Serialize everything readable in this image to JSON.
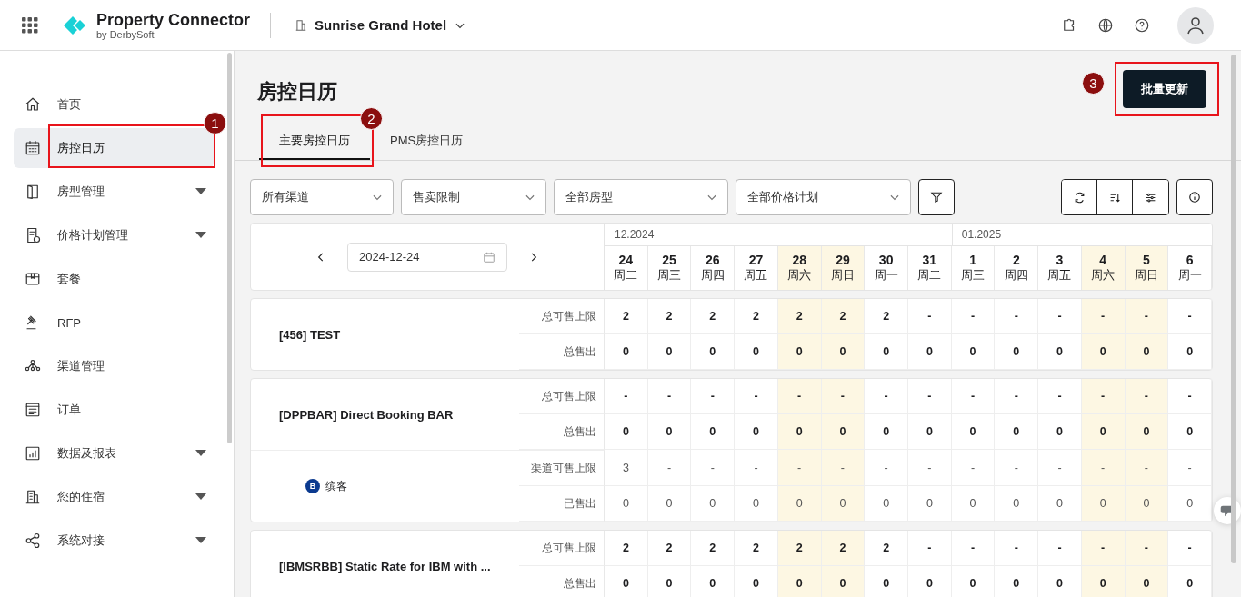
{
  "header": {
    "title": "Property Connector",
    "subtitle": "by DerbySoft",
    "hotel": "Sunrise Grand Hotel"
  },
  "sidebar": {
    "items": [
      {
        "label": "首页",
        "selected": false,
        "has_submenu": false
      },
      {
        "label": "房控日历",
        "selected": true,
        "has_submenu": false,
        "callout": {
          "number": "1"
        }
      },
      {
        "label": "房型管理",
        "selected": false,
        "has_submenu": true
      },
      {
        "label": "价格计划管理",
        "selected": false,
        "has_submenu": true
      },
      {
        "label": "套餐",
        "selected": false,
        "has_submenu": false
      },
      {
        "label": "RFP",
        "selected": false,
        "has_submenu": false
      },
      {
        "label": "渠道管理",
        "selected": false,
        "has_submenu": false
      },
      {
        "label": "订单",
        "selected": false,
        "has_submenu": false
      },
      {
        "label": "数据及报表",
        "selected": false,
        "has_submenu": true
      },
      {
        "label": "您的住宿",
        "selected": false,
        "has_submenu": true
      },
      {
        "label": "系统对接",
        "selected": false,
        "has_submenu": true
      }
    ]
  },
  "page": {
    "title": "房控日历",
    "action": {
      "label": "批量更新",
      "callout": {
        "number": "3"
      }
    }
  },
  "tabs": [
    {
      "label": "主要房控日历",
      "selected": true,
      "callout": {
        "number": "2"
      }
    },
    {
      "label": "PMS房控日历",
      "selected": false
    }
  ],
  "filters": [
    {
      "value": "所有渠道"
    },
    {
      "value": "售卖限制"
    },
    {
      "value": "全部房型"
    },
    {
      "value": "全部价格计划"
    }
  ],
  "date_field": {
    "value": "2024-12-24"
  },
  "months": [
    {
      "label": "12.2024",
      "days": [
        {
          "day": "24",
          "weekday": "周二",
          "weekend": false
        },
        {
          "day": "25",
          "weekday": "周三",
          "weekend": false
        },
        {
          "day": "26",
          "weekday": "周四",
          "weekend": false
        },
        {
          "day": "27",
          "weekday": "周五",
          "weekend": false
        },
        {
          "day": "28",
          "weekday": "周六",
          "weekend": true
        },
        {
          "day": "29",
          "weekday": "周日",
          "weekend": true
        },
        {
          "day": "30",
          "weekday": "周一",
          "weekend": false
        },
        {
          "day": "31",
          "weekday": "周二",
          "weekend": false
        }
      ]
    },
    {
      "label": "01.2025",
      "days": [
        {
          "day": "1",
          "weekday": "周三",
          "weekend": false
        },
        {
          "day": "2",
          "weekday": "周四",
          "weekend": false
        },
        {
          "day": "3",
          "weekday": "周五",
          "weekend": false
        },
        {
          "day": "4",
          "weekday": "周六",
          "weekend": true
        },
        {
          "day": "5",
          "weekday": "周日",
          "weekend": true
        },
        {
          "day": "6",
          "weekday": "周一",
          "weekend": false
        }
      ]
    }
  ],
  "rooms": [
    {
      "name": "[456] TEST",
      "rows": [
        {
          "label": "总可售上限",
          "values": [
            "2",
            "2",
            "2",
            "2",
            "2",
            "2",
            "2",
            "-",
            "-",
            "-",
            "-",
            "-",
            "-",
            "-"
          ]
        },
        {
          "label": "总售出",
          "values": [
            "0",
            "0",
            "0",
            "0",
            "0",
            "0",
            "0",
            "0",
            "0",
            "0",
            "0",
            "0",
            "0",
            "0"
          ]
        }
      ]
    },
    {
      "name": "[DPPBAR] Direct Booking BAR",
      "rows": [
        {
          "label": "总可售上限",
          "values": [
            "-",
            "-",
            "-",
            "-",
            "-",
            "-",
            "-",
            "-",
            "-",
            "-",
            "-",
            "-",
            "-",
            "-"
          ]
        },
        {
          "label": "总售出",
          "values": [
            "0",
            "0",
            "0",
            "0",
            "0",
            "0",
            "0",
            "0",
            "0",
            "0",
            "0",
            "0",
            "0",
            "0"
          ]
        }
      ],
      "channels": [
        {
          "name": "缤客",
          "badge": "B",
          "rows": [
            {
              "label": "渠道可售上限",
              "values": [
                "3",
                "-",
                "-",
                "-",
                "-",
                "-",
                "-",
                "-",
                "-",
                "-",
                "-",
                "-",
                "-",
                "-"
              ]
            },
            {
              "label": "已售出",
              "values": [
                "0",
                "0",
                "0",
                "0",
                "0",
                "0",
                "0",
                "0",
                "0",
                "0",
                "0",
                "0",
                "0",
                "0"
              ]
            }
          ]
        }
      ]
    },
    {
      "name": "[IBMSRBB] Static Rate for IBM with ...",
      "rows": [
        {
          "label": "总可售上限",
          "values": [
            "2",
            "2",
            "2",
            "2",
            "2",
            "2",
            "2",
            "-",
            "-",
            "-",
            "-",
            "-",
            "-",
            "-"
          ]
        },
        {
          "label": "总售出",
          "values": [
            "0",
            "0",
            "0",
            "0",
            "0",
            "0",
            "0",
            "0",
            "0",
            "0",
            "0",
            "0",
            "0",
            "0"
          ]
        }
      ]
    }
  ]
}
